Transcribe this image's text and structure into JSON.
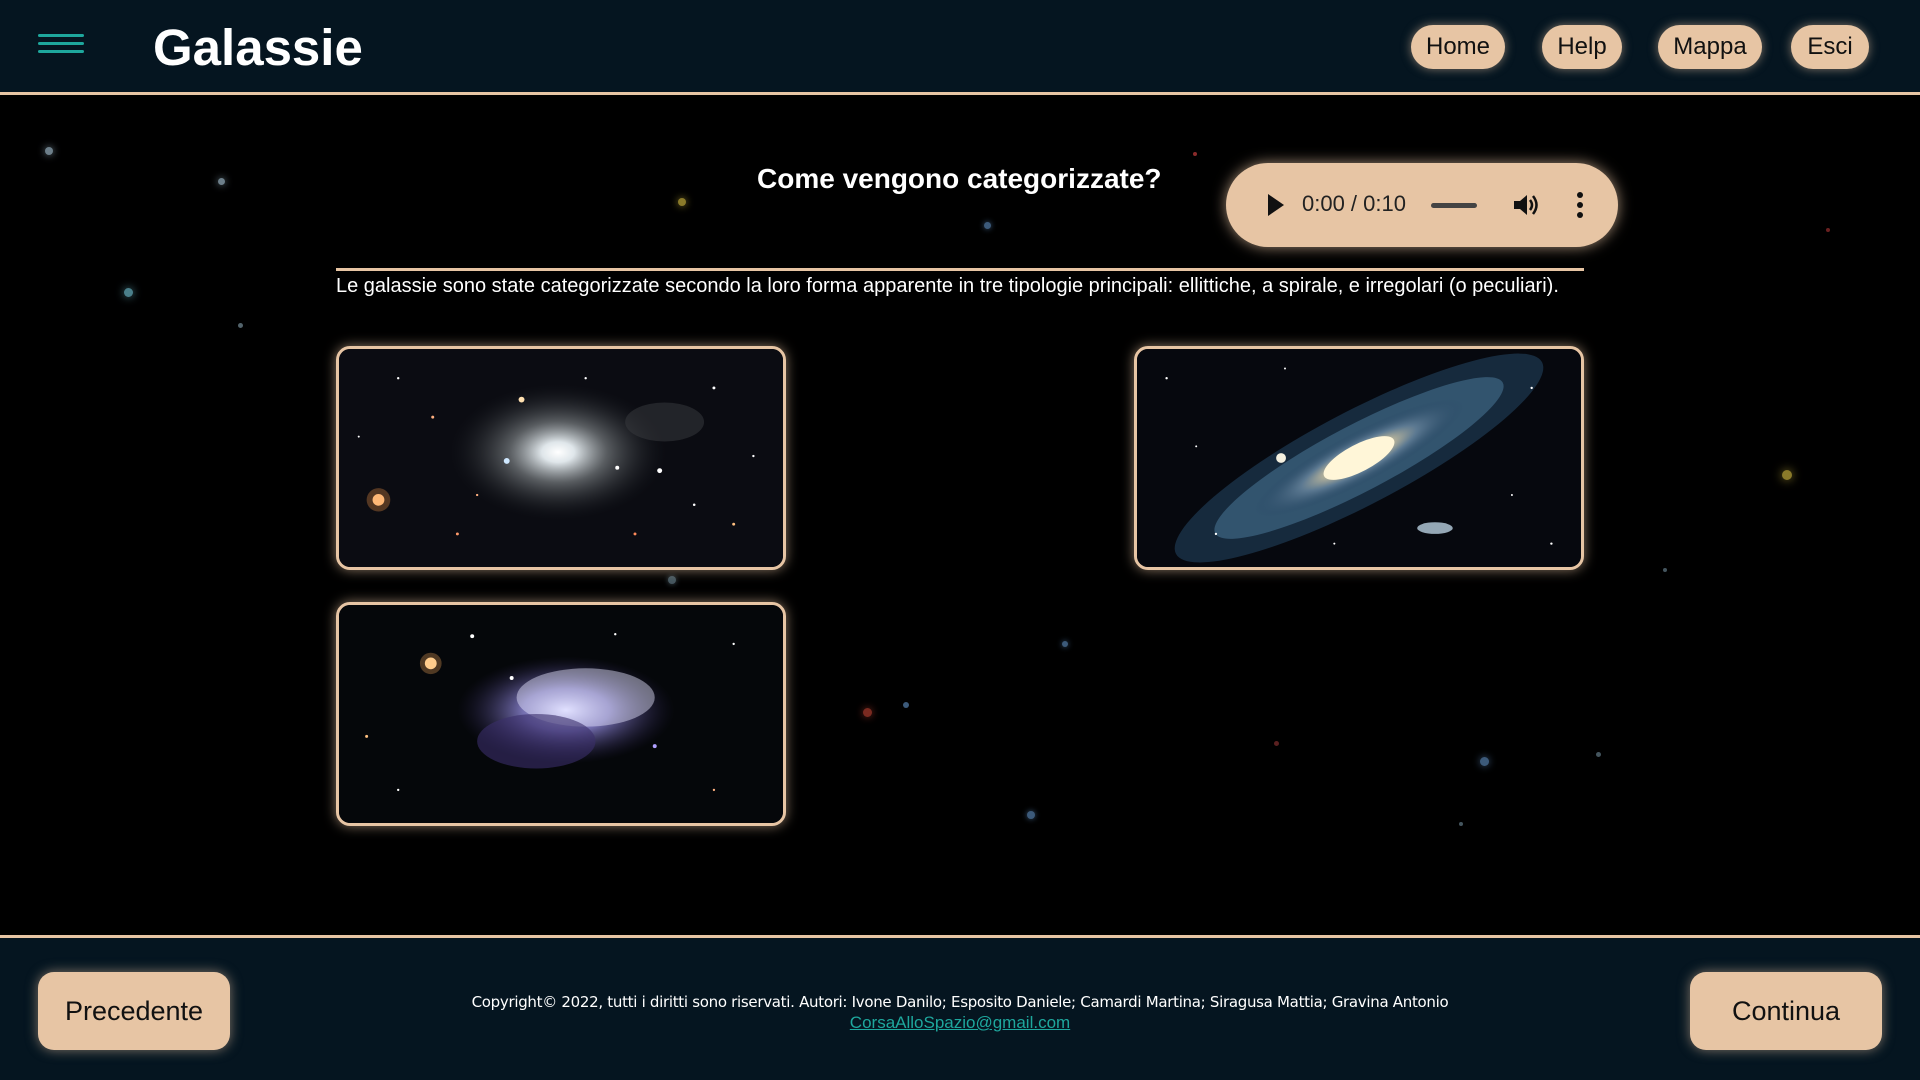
{
  "header": {
    "title": "Galassie",
    "nav": [
      "Home",
      "Help",
      "Mappa",
      "Esci"
    ]
  },
  "main": {
    "heading": "Come vengono categorizzate?",
    "audio": {
      "time": "0:00 / 0:10"
    },
    "paragraph": "Le galassie sono state categorizzate secondo la loro forma apparente in tre tipologie principali: ellittiche, a spirale, e irregolari (o peculiari).",
    "images": [
      "elliptical-galaxy",
      "spiral-galaxy",
      "irregular-galaxy"
    ]
  },
  "footer": {
    "prev": "Precedente",
    "next": "Continua",
    "copyright": "Copyright© 2022, tutti i diritti sono riservati. Autori: Ivone Danilo; Esposito Daniele; Camardi Martina; Siragusa Mattia; Gravina Antonio",
    "email": "CorsaAlloSpazio@gmail.com"
  },
  "colors": {
    "accent": "#e7c5a4",
    "bar": "#051520",
    "link": "#1ea79d"
  }
}
